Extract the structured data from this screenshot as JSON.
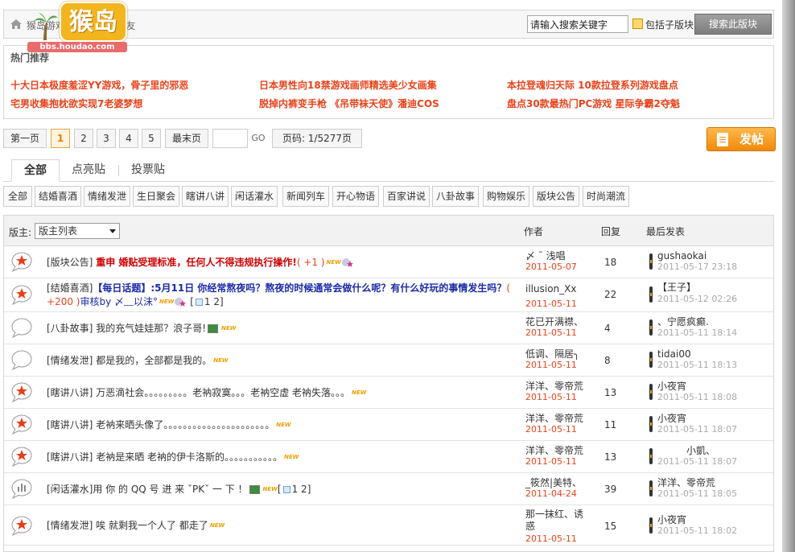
{
  "breadcrumb": [
    "猴岛游戏论坛",
    "聊天交友"
  ],
  "logo": {
    "text": "猴岛",
    "url_text": "bbs.houdao.com"
  },
  "search": {
    "placeholder": "请输入搜索关键字",
    "include_sub_label": "包括子版块",
    "button_label": "搜索此版块"
  },
  "hot": {
    "title": "热门推荐",
    "items": [
      "十大日本极度羞涩YY游戏，骨子里的邪恶",
      "日本男性向18禁游戏画师精选美少女画集",
      "本拉登魂归天际 10款拉登系列游戏盘点",
      "宅男收集抱枕欲实现7老婆梦想",
      "脱掉内裤变手枪 《吊带袜天使》潘迪COS",
      "盘点30款最热门PC游戏 星际争霸2夺魁"
    ]
  },
  "pager": {
    "first": "第一页",
    "pages": [
      "1",
      "2",
      "3",
      "4",
      "5"
    ],
    "current": "1",
    "last": "最末页",
    "go": "GO",
    "info": "页码: 1/5277页"
  },
  "post_button": "发帖",
  "tabs": [
    "全部",
    "点亮贴",
    "投票贴"
  ],
  "categories": [
    "全部",
    "结婚喜酒",
    "情绪发泄",
    "生日聚会",
    "瞎讲八讲",
    "闲话灌水",
    "新闻列车",
    "开心物语",
    "百家讲说",
    "八卦故事",
    "购物娱乐",
    "版块公告",
    "时尚潮流"
  ],
  "table": {
    "moderator_label": "版主:",
    "moderator_select": "版主列表",
    "col_author": "作者",
    "col_replies": "回复",
    "col_last": "最后发表",
    "rows": [
      {
        "icon": "hot-icon",
        "cat": "[版块公告]",
        "title": "重申 婚贴受理标准，任何人不得违规执行操作!",
        "pts": "( +1 )",
        "author": "〆 ˉ  浅唱",
        "adate": "2011-05-07",
        "replies": "18",
        "last": "gushaokai",
        "ldate": "2011-05-17 23:18"
      },
      {
        "icon": "hot-icon",
        "cat": "[结婚喜酒]",
        "title": "【每日话题】:5月11日 你经常熬夜吗？熬夜的时候通常会做什么呢？有什么好玩的事情发生吗？",
        "pts": "( +200 )",
        "rev": "审核by 〆﹏以沫°",
        "pages": "1 2",
        "author": "illusion_Xx",
        "adate": "2011-05-11",
        "replies": "22",
        "last": "【王子】",
        "ldate": "2011-05-12 02:26"
      },
      {
        "icon": "bubble-icon",
        "cat": "[八卦故事]",
        "title": "我的充气娃娃那？浪子哥!",
        "author": "花已开满襟、",
        "adate": "2011-05-11",
        "replies": "4",
        "last": "、宁愿疯癫.",
        "ldate": "2011-05-11 18:14"
      },
      {
        "icon": "bubble-icon",
        "cat": "[情绪发泄]",
        "title": "都是我的，全部都是我的。",
        "author": "低调、隔居╮",
        "adate": "2011-05-11",
        "replies": "8",
        "last": "tidai00",
        "ldate": "2011-05-11 18:13"
      },
      {
        "icon": "hot-icon",
        "cat": "[瞎讲八讲]",
        "title": "万恶滴社会。。。。。。。。。老衲寂寞。。。老衲空虚 老衲失落。。。",
        "author": "洋洋、零帝荒",
        "adate": "2011-05-11",
        "replies": "13",
        "last": "小夜宵",
        "ldate": "2011-05-11 18:08"
      },
      {
        "icon": "hot-icon",
        "cat": "[瞎讲八讲]",
        "title": "老衲来晒头像了。。。。。。。。。。。。。。。。。。。。。。",
        "author": "洋洋、零帝荒",
        "adate": "2011-05-11",
        "replies": "11",
        "last": "小夜宵",
        "ldate": "2011-05-11 18:07"
      },
      {
        "icon": "hot-icon",
        "cat": "[瞎讲八讲]",
        "title": "老衲是来晒 老衲的伊卡洛斯的。。。。。。。。。。。",
        "author": "洋洋、零帝荒",
        "adate": "2011-05-11",
        "replies": "13",
        "last": "小凱、",
        "ldate": "2011-05-11 18:07"
      },
      {
        "icon": "poll-icon",
        "cat": "[闲话灌水]",
        "title": "用 你 的 QQ 号 进 来 ˇPKˇ 一 下 ！",
        "pages": "1 2",
        "author": "_筱然|美特、",
        "adate": "2011-04-24",
        "replies": "39",
        "last": "洋洋、零帝荒",
        "ldate": "2011-05-11 18:05"
      },
      {
        "icon": "hot-icon",
        "cat": "[情绪发泄]",
        "title": "唉 就剩我一个人了 都走了",
        "author": "那一抹红、诱惑",
        "adate": "2011-05-11",
        "replies": "15",
        "last": "小夜宵",
        "ldate": "2011-05-11 18:02"
      }
    ]
  }
}
